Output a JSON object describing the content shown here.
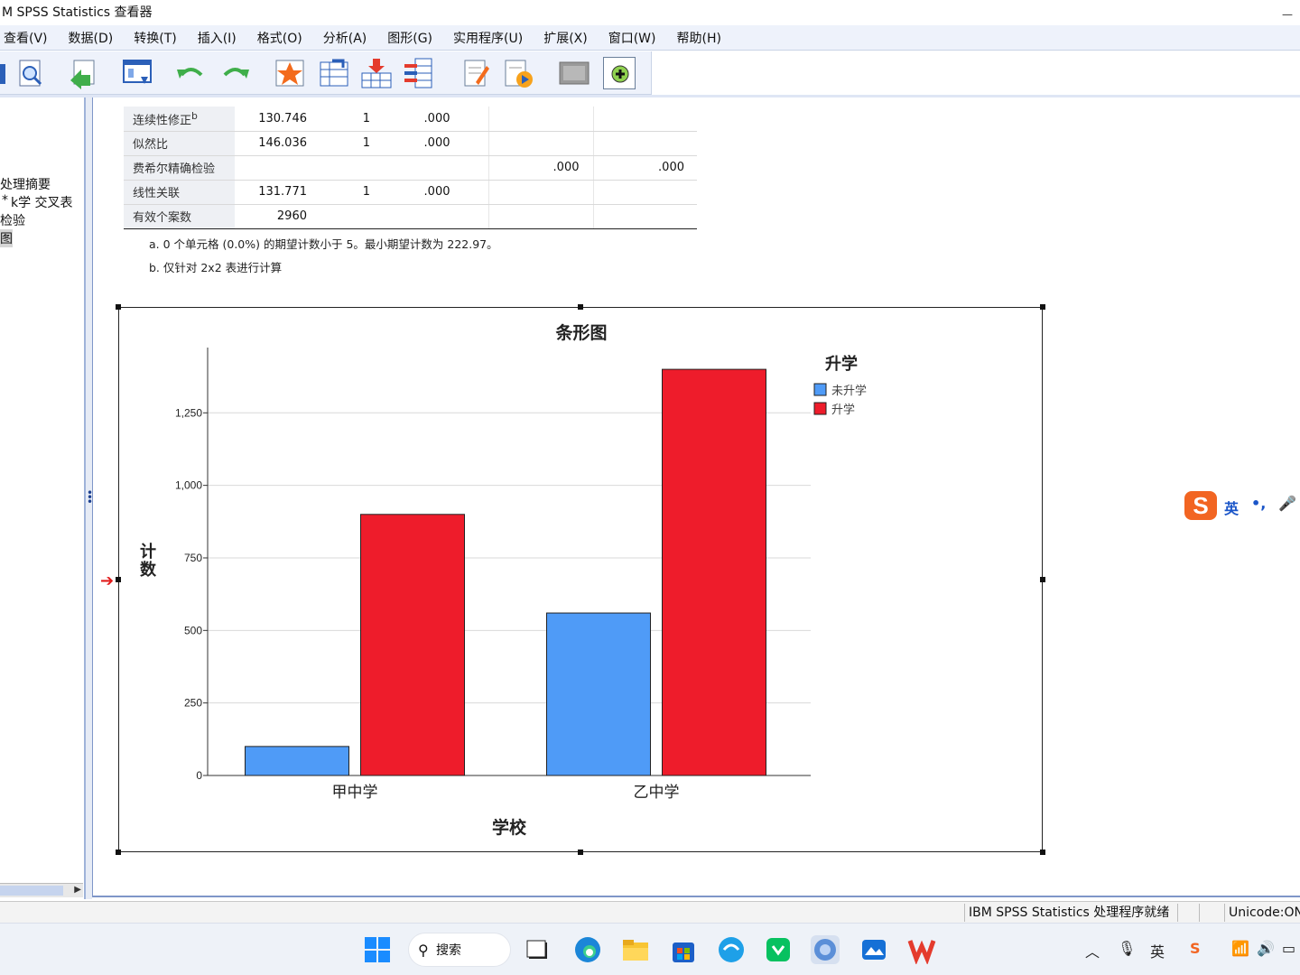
{
  "window": {
    "title": "M SPSS Statistics 查看器"
  },
  "menu": [
    "查看(V)",
    "数据(D)",
    "转换(T)",
    "插入(I)",
    "格式(O)",
    "分析(A)",
    "图形(G)",
    "实用程序(U)",
    "扩展(X)",
    "窗口(W)",
    "帮助(H)"
  ],
  "toolbar": {
    "icons": [
      "open-icon",
      "print-preview-icon",
      "export-icon",
      "recall-dialog-icon",
      "undo-icon",
      "redo-icon",
      "goto-output-icon",
      "goto-case-icon",
      "goto-variable-icon",
      "insert-cases-icon",
      "insert-variable-icon",
      "insert-heading-icon",
      "insert-title-icon",
      "output-frame-icon",
      "designate-window-icon"
    ]
  },
  "outline": {
    "items": [
      "处理摘要",
      "*",
      "k学 交叉表",
      "检验",
      "图"
    ],
    "selected": "图"
  },
  "stats_table": {
    "rows": [
      {
        "label": "连续性修正",
        "sup": "b",
        "value": "130.746",
        "df": "1",
        "sig": ".000",
        "exact2": "",
        "exact1": ""
      },
      {
        "label": "似然比",
        "sup": "",
        "value": "146.036",
        "df": "1",
        "sig": ".000",
        "exact2": "",
        "exact1": ""
      },
      {
        "label": "费希尔精确检验",
        "sup": "",
        "value": "",
        "df": "",
        "sig": "",
        "exact2": ".000",
        "exact1": ".000"
      },
      {
        "label": "线性关联",
        "sup": "",
        "value": "131.771",
        "df": "1",
        "sig": ".000",
        "exact2": "",
        "exact1": ""
      },
      {
        "label": "有效个案数",
        "sup": "",
        "value": "2960",
        "df": "",
        "sig": "",
        "exact2": "",
        "exact1": ""
      }
    ],
    "notes": [
      "a. 0 个单元格 (0.0%) 的期望计数小于 5。最小期望计数为 222.97。",
      "b. 仅针对 2x2 表进行计算"
    ]
  },
  "chart_data": {
    "type": "bar",
    "title": "条形图",
    "xlabel": "学校",
    "ylabel": "计数",
    "categories": [
      "甲中学",
      "乙中学"
    ],
    "series": [
      {
        "name": "未升学",
        "values": [
          100,
          560
        ],
        "color": "#4f9bf7"
      },
      {
        "name": "升学",
        "values": [
          900,
          1400
        ],
        "color": "#ee1c2b"
      }
    ],
    "legend_title": "升学",
    "legend_position": "top-right",
    "ylim": [
      0,
      1475
    ],
    "yticks": [
      0,
      250,
      500,
      750,
      1000,
      1250
    ],
    "ytick_labels": [
      "0",
      "250",
      "500",
      "750",
      "1,000",
      "1,250"
    ],
    "grid": true
  },
  "ime": {
    "lang": "英"
  },
  "status": {
    "processor": "IBM SPSS Statistics 处理程序就绪",
    "unicode": "Unicode:ON"
  },
  "taskbar": {
    "search_label": "搜索",
    "apps": [
      "windows-start-icon",
      "task-view-icon",
      "edge-icon",
      "file-explorer-icon",
      "store-icon",
      "browser-icon",
      "wechat-icon",
      "spss-icon",
      "photos-icon",
      "wps-icon"
    ],
    "tray_lang": "英"
  }
}
